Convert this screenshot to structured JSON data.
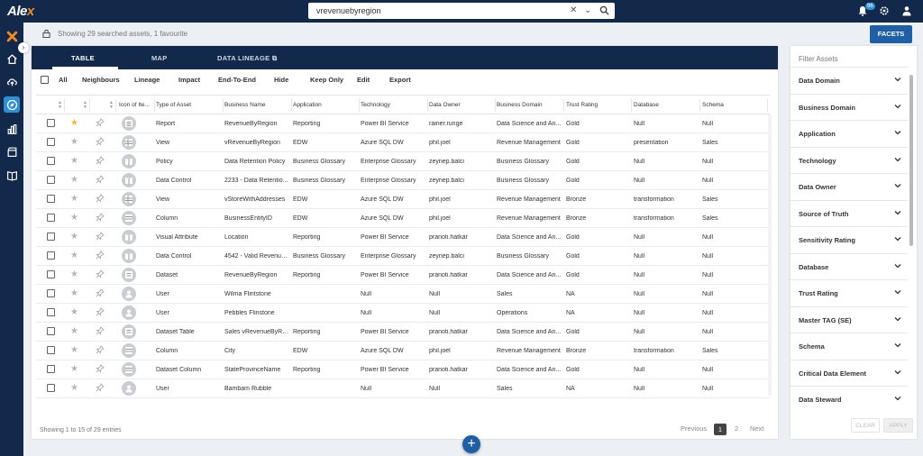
{
  "app": {
    "logo_text": "Ale",
    "logo_x": "x"
  },
  "search": {
    "value": "vrevenuebyregion"
  },
  "notifications": {
    "count": "96"
  },
  "status": {
    "text": "Showing 29 searched assets, 1 favourite"
  },
  "facets_button": "FACETS",
  "tabs": [
    {
      "label": "TABLE",
      "active": true
    },
    {
      "label": "MAP"
    },
    {
      "label": "DATA LINEAGE"
    }
  ],
  "actions": {
    "all": "All",
    "items": [
      "Neighbours",
      "Lineage",
      "Impact",
      "End-To-End",
      "Hide",
      "Keep Only",
      "Edit",
      "Export"
    ]
  },
  "columns": [
    "Icon of Ite...",
    "Type of Asset",
    "Business Name",
    "Application",
    "Technology",
    "Data Owner",
    "Business Domain",
    "Trust Rating",
    "Database",
    "Schema"
  ],
  "rows": [
    {
      "fav": true,
      "icon": "report-icon",
      "type": "Report",
      "name": "RevenueByRegion",
      "app": "Reporting",
      "tech": "Power BI Service",
      "owner": "rainer.runge",
      "domain": "Data Science and An...",
      "trust": "Gold",
      "db": "Null",
      "schema": "Null"
    },
    {
      "fav": false,
      "icon": "view-icon",
      "type": "View",
      "name": "vRevenueByRegion",
      "app": "EDW",
      "tech": "Azure SQL DW",
      "owner": "phil.joel",
      "domain": "Revenue Management",
      "trust": "Gold",
      "db": "presentation",
      "schema": "Sales"
    },
    {
      "fav": false,
      "icon": "book-icon",
      "type": "Policy",
      "name": "Data Retention Policy",
      "app": "Business Glossary",
      "tech": "Enterprise Glossary",
      "owner": "zeynep.balci",
      "domain": "Business Glossary",
      "trust": "Gold",
      "db": "Null",
      "schema": "Null"
    },
    {
      "fav": false,
      "icon": "book-icon",
      "type": "Data Control",
      "name": "2233 - Data Retentio...",
      "app": "Business Glossary",
      "tech": "Enterprise Glossary",
      "owner": "zeynep.balci",
      "domain": "Business Glossary",
      "trust": "Gold",
      "db": "Null",
      "schema": "Null"
    },
    {
      "fav": false,
      "icon": "view-icon",
      "type": "View",
      "name": "vStoreWithAddresses",
      "app": "EDW",
      "tech": "Azure SQL DW",
      "owner": "phil.joel",
      "domain": "Revenue Management",
      "trust": "Bronze",
      "db": "transformation",
      "schema": "Sales"
    },
    {
      "fav": false,
      "icon": "column-icon",
      "type": "Column",
      "name": "BusinessEntityID",
      "app": "EDW",
      "tech": "Azure SQL DW",
      "owner": "phil.joel",
      "domain": "Revenue Management",
      "trust": "Bronze",
      "db": "transformation",
      "schema": "Sales"
    },
    {
      "fav": false,
      "icon": "book-icon",
      "type": "Visual Attribute",
      "name": "Location",
      "app": "Reporting",
      "tech": "Power BI Service",
      "owner": "pranoti.hatkar",
      "domain": "Data Science and An...",
      "trust": "Gold",
      "db": "Null",
      "schema": "Null"
    },
    {
      "fav": false,
      "icon": "book-icon",
      "type": "Data Control",
      "name": "4542 - Valid Revenue...",
      "app": "Business Glossary",
      "tech": "Enterprise Glossary",
      "owner": "zeynep.balci",
      "domain": "Business Glossary",
      "trust": "Gold",
      "db": "Null",
      "schema": "Null"
    },
    {
      "fav": false,
      "icon": "dataset-icon",
      "type": "Dataset",
      "name": "RevenueByRegion",
      "app": "Reporting",
      "tech": "Power BI Service",
      "owner": "pranoti.hatkar",
      "domain": "Data Science and An...",
      "trust": "Gold",
      "db": "Null",
      "schema": "Null"
    },
    {
      "fav": false,
      "icon": "user-icon",
      "type": "User",
      "name": "Wilma Flintstone",
      "app": "",
      "tech": "Null",
      "owner": "Null",
      "domain": "Sales",
      "trust": "NA",
      "db": "Null",
      "schema": "Null"
    },
    {
      "fav": false,
      "icon": "user-icon",
      "type": "User",
      "name": "Pebbles Flinstone",
      "app": "",
      "tech": "Null",
      "owner": "Null",
      "domain": "Operations",
      "trust": "NA",
      "db": "Null",
      "schema": "Null"
    },
    {
      "fav": false,
      "icon": "dataset-icon",
      "type": "Dataset Table",
      "name": "Sales vRevenueByRe...",
      "app": "Reporting",
      "tech": "Power BI Service",
      "owner": "pranoti.hatkar",
      "domain": "Data Science and An...",
      "trust": "Gold",
      "db": "Null",
      "schema": "Null"
    },
    {
      "fav": false,
      "icon": "column-icon",
      "type": "Column",
      "name": "City",
      "app": "EDW",
      "tech": "Azure SQL DW",
      "owner": "phil.joel",
      "domain": "Revenue Management",
      "trust": "Bronze",
      "db": "transformation",
      "schema": "Sales"
    },
    {
      "fav": false,
      "icon": "column-icon",
      "type": "Dataset Column",
      "name": "StateProvinceName",
      "app": "Reporting",
      "tech": "Power BI Service",
      "owner": "pranoti.hatkar",
      "domain": "Data Science and An...",
      "trust": "Gold",
      "db": "Null",
      "schema": "Null"
    },
    {
      "fav": false,
      "icon": "user-icon",
      "type": "User",
      "name": "Bambam Rubble",
      "app": "",
      "tech": "Null",
      "owner": "Null",
      "domain": "Sales",
      "trust": "NA",
      "db": "Null",
      "schema": "Null"
    }
  ],
  "footer": {
    "info": "Showing 1 to 15 of 29 entries",
    "previous": "Previous",
    "page1": "1",
    "page2": "2",
    "next": "Next"
  },
  "fab_label": "+",
  "filter": {
    "title": "Filter Assets",
    "items": [
      "Data Domain",
      "Business Domain",
      "Application",
      "Technology",
      "Data Owner",
      "Source of Truth",
      "Sensitivity Rating",
      "Database",
      "Trust Rating",
      "Master TAG (SE)",
      "Schema",
      "Critical Data Element",
      "Data Steward"
    ],
    "clear": "CLEAR",
    "apply": "APPLY"
  }
}
